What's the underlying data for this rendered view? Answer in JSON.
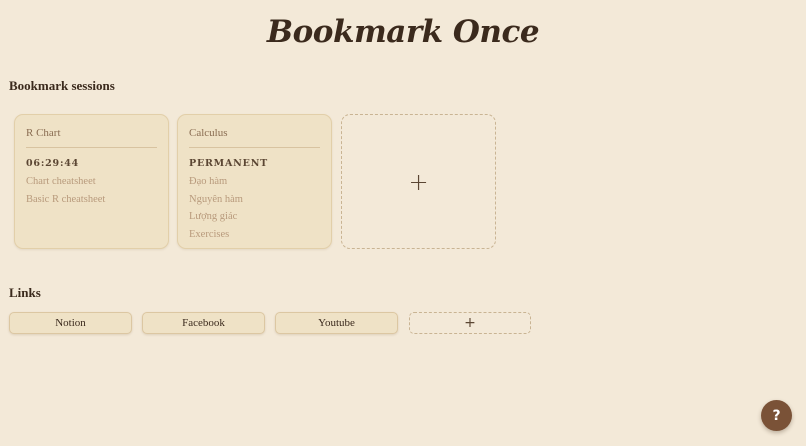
{
  "app": {
    "title": "Bookmark Once"
  },
  "sessions": {
    "heading": "Bookmark sessions",
    "cards": [
      {
        "title": "R Chart",
        "status": "06:29:44",
        "items": [
          "Chart cheatsheet",
          "Basic R cheatsheet"
        ]
      },
      {
        "title": "Calculus",
        "status": "PERMANENT",
        "items": [
          "Đạo hàm",
          "Nguyên hàm",
          "Lượng giác",
          "Exercises"
        ]
      }
    ],
    "add_label": "+"
  },
  "links": {
    "heading": "Links",
    "items": [
      "Notion",
      "Facebook",
      "Youtube"
    ],
    "add_label": "+"
  },
  "help": {
    "label": "?"
  },
  "colors": {
    "background": "#f3e9d8",
    "card": "#efe2c6",
    "help_button": "#7a5237",
    "title_text": "#3b2a1d"
  }
}
